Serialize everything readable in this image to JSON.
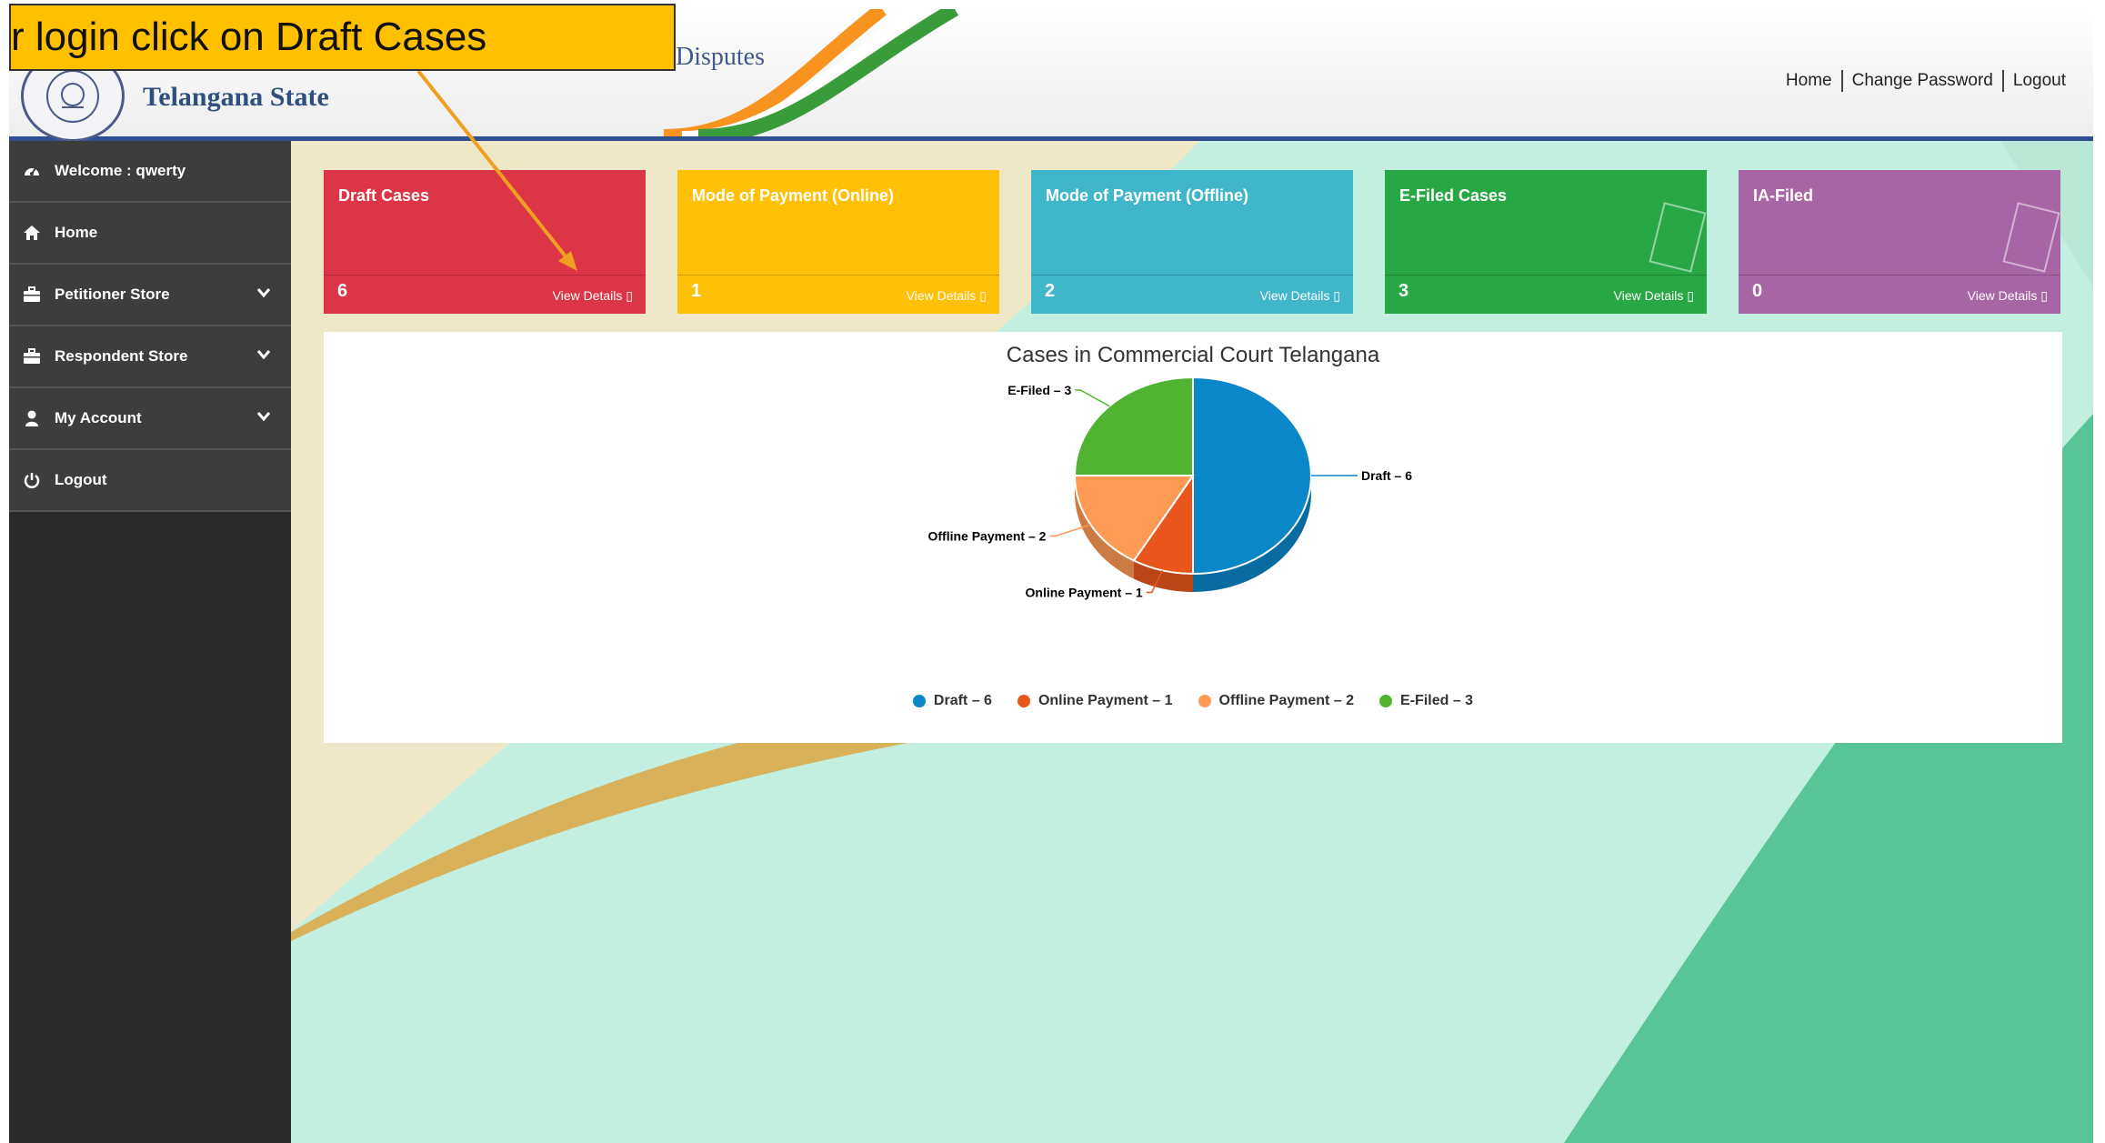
{
  "callout": {
    "text": "r login click on Draft Cases"
  },
  "header": {
    "title": "Telangana State",
    "subtitle": "Disputes",
    "links": {
      "home": "Home",
      "change_password": "Change Password",
      "logout": "Logout"
    }
  },
  "sidebar": {
    "items": [
      {
        "label": "Welcome : qwerty",
        "icon": "dashboard-icon"
      },
      {
        "label": "Home",
        "icon": "home-icon"
      },
      {
        "label": "Petitioner Store",
        "icon": "briefcase-icon"
      },
      {
        "label": "Respondent Store",
        "icon": "briefcase-icon"
      },
      {
        "label": "My Account",
        "icon": "user-icon"
      },
      {
        "label": "Logout",
        "icon": "power-icon"
      }
    ]
  },
  "cards": [
    {
      "title": "Draft Cases",
      "count": "6",
      "link": "View Details ▯",
      "color": "#dc3545"
    },
    {
      "title": "Mode of Payment (Online)",
      "count": "1",
      "link": "View Details ▯",
      "color": "#ffc107"
    },
    {
      "title": "Mode of Payment (Offline)",
      "count": "2",
      "link": "View Details ▯",
      "color": "#3fb6c9"
    },
    {
      "title": "E-Filed Cases",
      "count": "3",
      "link": "View Details ▯",
      "color": "#28a745"
    },
    {
      "title": "IA-Filed",
      "count": "0",
      "link": "View Details ▯",
      "color": "#a865a5"
    }
  ],
  "chart_data": {
    "type": "pie",
    "title": "Cases in Commercial Court Telangana",
    "slices": [
      {
        "label": "Draft",
        "value": 6,
        "text": "Draft – 6",
        "color": "#0a87c8"
      },
      {
        "label": "Online Payment",
        "value": 1,
        "text": "Online Payment – 1",
        "color": "#e8561b"
      },
      {
        "label": "Offline Payment",
        "value": 2,
        "text": "Offline Payment – 2",
        "color": "#ff9a55"
      },
      {
        "label": "E-Filed",
        "value": 3,
        "text": "E-Filed – 3",
        "color": "#50b432"
      }
    ],
    "legend_position": "bottom"
  }
}
